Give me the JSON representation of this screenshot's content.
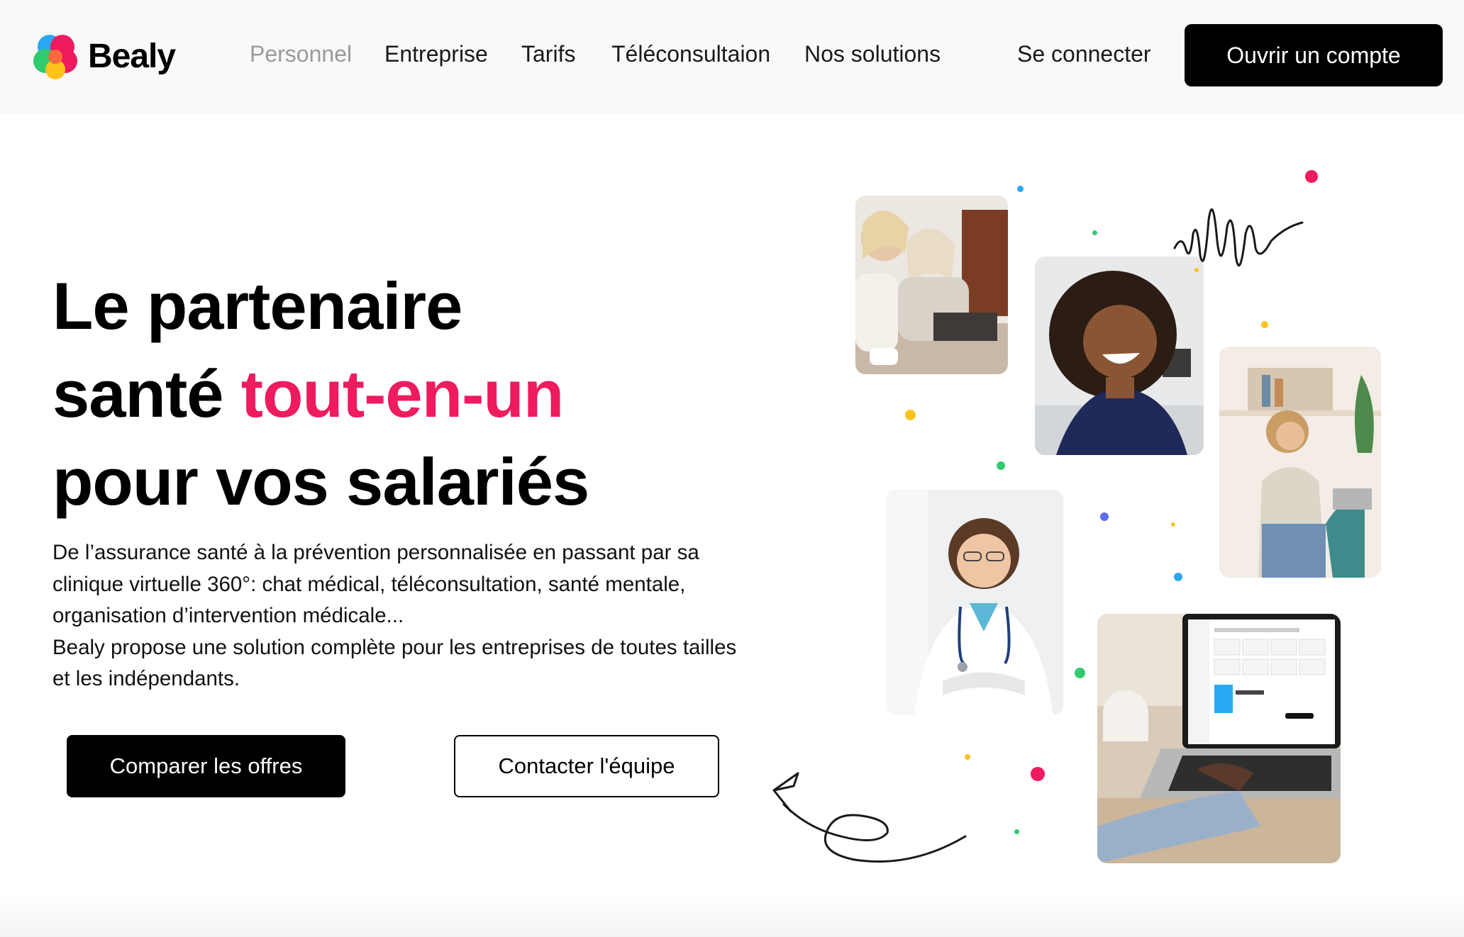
{
  "brand": {
    "name": "Bealy",
    "accent_color": "#ee1b5e",
    "logo_colors": [
      "#ee1b5e",
      "#2fcb6f",
      "#2aa8f2",
      "#ffc21a"
    ]
  },
  "nav": {
    "items": [
      {
        "label": "Personnel",
        "active": false
      },
      {
        "label": "Entreprise"
      },
      {
        "label": "Tarifs"
      },
      {
        "label": "Téléconsultaion"
      },
      {
        "label": "Nos solutions"
      }
    ],
    "login_label": "Se connecter",
    "signup_label": "Ouvrir un compte"
  },
  "hero": {
    "headline_line1": "Le partenaire",
    "headline_line2_prefix": "santé",
    "headline_line2_accent": "tout-en-un",
    "headline_line3": "pour vos salariés",
    "description_p1": "De l’assurance santé à la prévention personnalisée en passant par sa clinique virtuelle 360°: chat médical, téléconsultation, santé mentale, organisation d’intervention médicale...",
    "description_p2": "Bealy propose une solution complète pour les entreprises de toutes tailles et les indépendants.",
    "cta_primary": "Comparer les offres",
    "cta_secondary": "Contacter l'équipe"
  },
  "illustrations": {
    "photo_icons": [
      "women-laptop-photo",
      "smiling-woman-photo",
      "woman-phone-photo",
      "doctor-photo",
      "laptop-app-photo"
    ]
  }
}
